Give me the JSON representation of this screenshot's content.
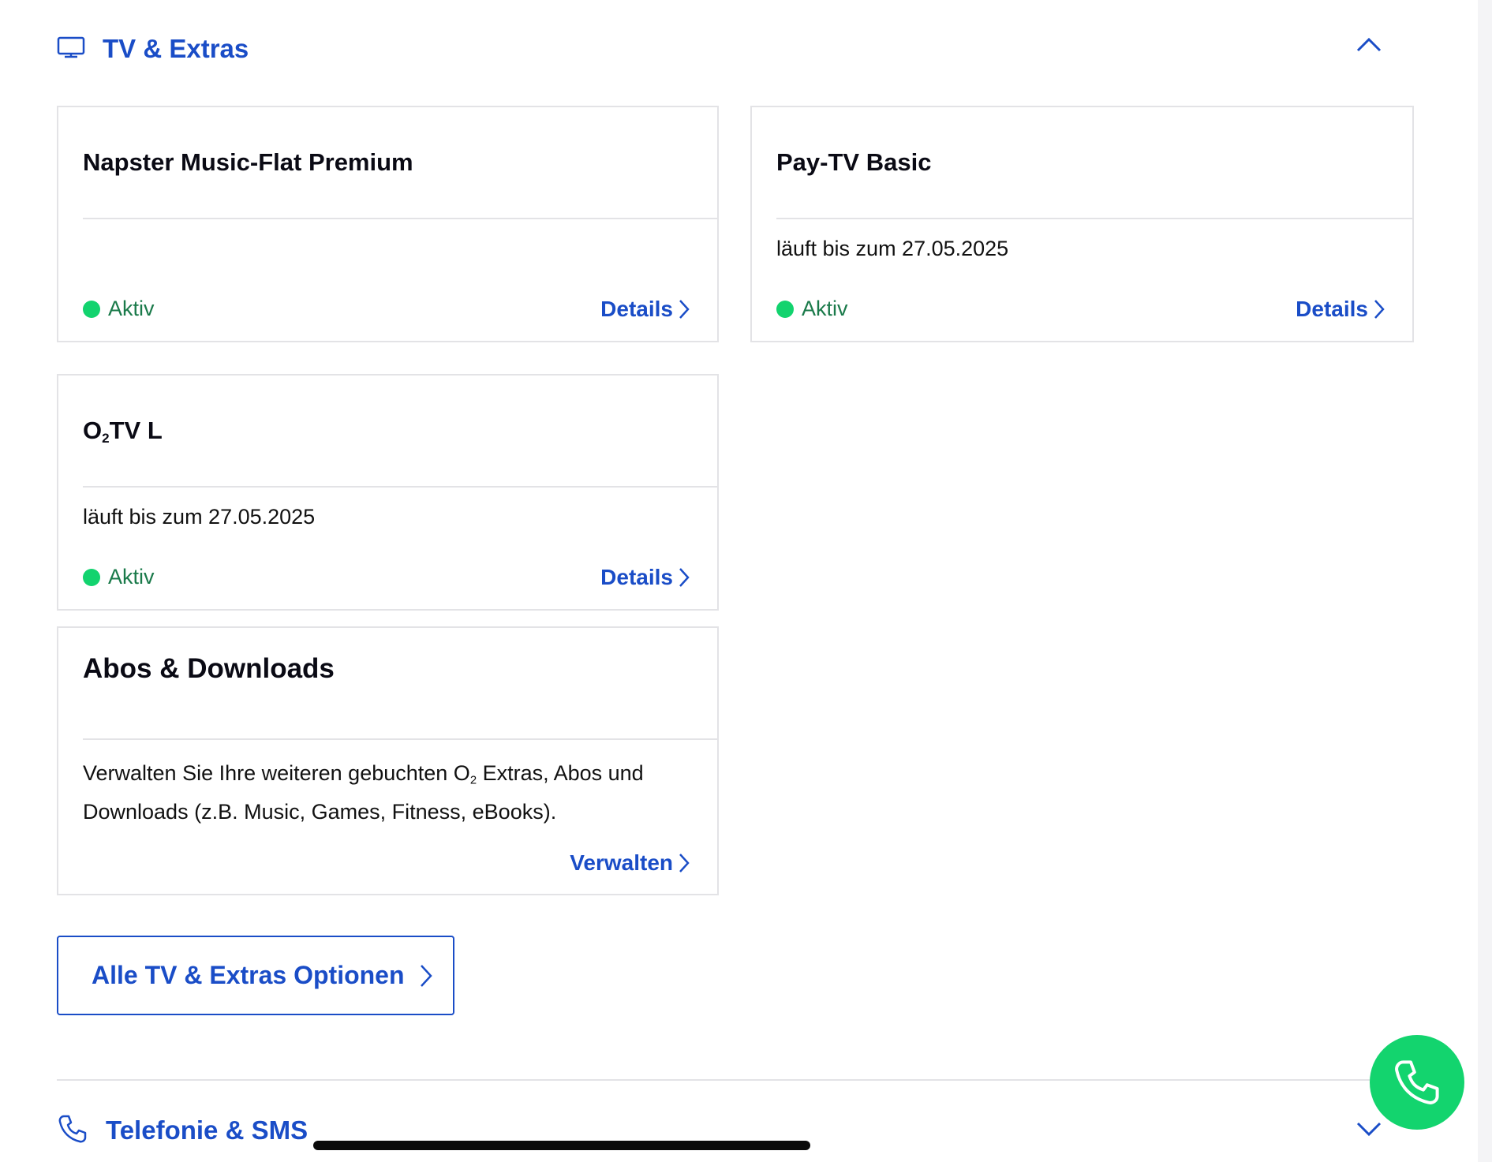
{
  "tv_section": {
    "title": "TV & Extras",
    "icon": "tv-icon",
    "toggle_icon": "chevron-up-icon"
  },
  "cards": [
    {
      "title": "Napster Music-Flat Premium",
      "info": "",
      "status": "Aktiv",
      "link": "Details"
    },
    {
      "title": "Pay-TV Basic",
      "info": "läuft bis zum 27.05.2025",
      "status": "Aktiv",
      "link": "Details"
    },
    {
      "title_prefix": "O",
      "title_sub": "2",
      "title_suffix": "TV L",
      "info": "läuft bis zum 27.05.2025",
      "status": "Aktiv",
      "link": "Details"
    }
  ],
  "abos": {
    "title": "Abos & Downloads",
    "text_part1": "Verwalten Sie Ihre weiteren gebuchten O",
    "text_sub": "2",
    "text_part2": " Extras, Abos und",
    "text_line2": "Downloads (z.B. Music, Games, Fitness, eBooks).",
    "link": "Verwalten"
  },
  "all_options_button": "Alle TV & Extras Optionen",
  "phone_section": {
    "title": "Telefonie & SMS",
    "icon": "phone-icon",
    "toggle_icon": "chevron-down-icon"
  },
  "colors": {
    "brand_blue": "#1a4dc7",
    "status_green": "#12d36e",
    "fab_green": "#13d46e"
  }
}
